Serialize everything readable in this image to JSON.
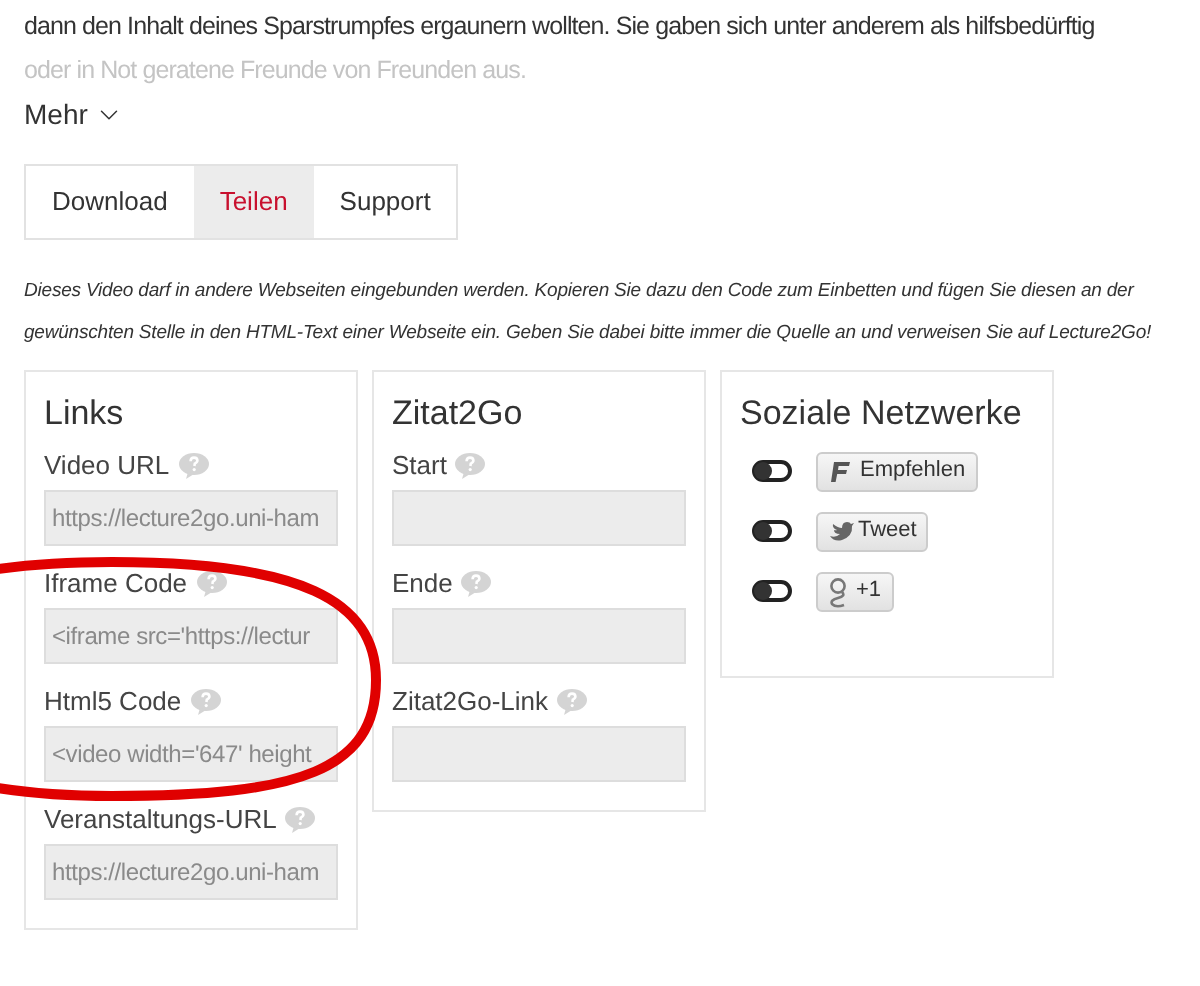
{
  "description": {
    "lines": [
      "dann den Inhalt deines Sparstrumpfes ergaunern wollten. Sie gaben sich unter anderem als hilfsbedürftig",
      "oder in Not geratene Freunde von Freunden aus."
    ],
    "more": "Mehr"
  },
  "tabs": [
    {
      "label": "Download",
      "selected": false
    },
    {
      "label": "Teilen",
      "selected": true
    },
    {
      "label": "Support",
      "selected": false
    }
  ],
  "notice": "Dieses Video darf in andere Webseiten eingebunden werden. Kopieren Sie dazu den Code zum Einbetten und fügen Sie diesen an der gewünschten Stelle in den HTML-Text einer Webseite ein. Geben Sie dabei bitte immer die Quelle an und verweisen Sie auf Lecture2Go!",
  "panels": [
    {
      "title": "Links",
      "kind": "fields",
      "fields": [
        {
          "label": "Video URL",
          "value": "https://lecture2go.uni-ham"
        },
        {
          "label": "Iframe Code",
          "value": "<iframe src='https://lectur"
        },
        {
          "label": "Html5 Code",
          "value": "<video width='647' height"
        },
        {
          "label": "Veranstaltungs-URL",
          "value": "https://lecture2go.uni-ham"
        }
      ]
    },
    {
      "title": "Zitat2Go",
      "kind": "fields",
      "fields": [
        {
          "label": "Start"
        },
        {
          "label": "Ende"
        },
        {
          "label": "Zitat2Go-Link"
        }
      ]
    },
    {
      "title": "Soziale Netzwerke",
      "kind": "social",
      "items": [
        {
          "kind": "facebook",
          "label": "Empfehlen",
          "on": false
        },
        {
          "kind": "twitter",
          "label": "Tweet",
          "on": false
        },
        {
          "kind": "google",
          "label": "+1",
          "on": false
        }
      ]
    }
  ]
}
